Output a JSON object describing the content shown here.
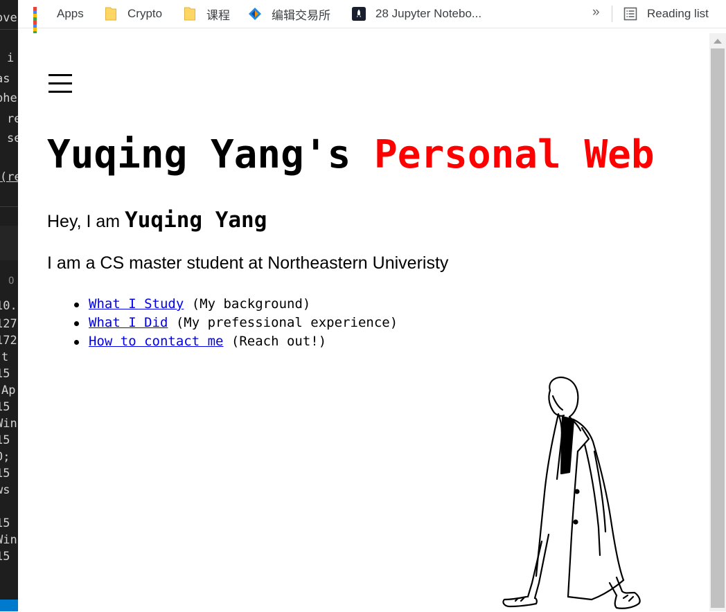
{
  "browser": {
    "bookmarks": [
      {
        "label": "Apps",
        "icon": "apps-grid-icon"
      },
      {
        "label": "Crypto",
        "icon": "folder-icon"
      },
      {
        "label": "课程",
        "icon": "folder-icon"
      },
      {
        "label": "编辑交易所",
        "icon": "exchange-logo-icon"
      },
      {
        "label": "28 Jupyter Notebo...",
        "icon": "rocket-icon"
      }
    ],
    "overflow_label": "»",
    "reading_list_label": "Reading list"
  },
  "editor_strip": {
    "lines": [
      "ove",
      "i",
      "as",
      "phe",
      "re",
      "se",
      "(re",
      "O",
      "10.",
      "127",
      "172",
      "t",
      "15",
      "Ap",
      "15",
      "Win",
      "15",
      "0;",
      "15",
      "ws",
      "15",
      "Win",
      "15"
    ]
  },
  "page": {
    "title_main": "Yuqing Yang's",
    "title_accent": "Personal Web",
    "greeting_prefix": "Hey, I am",
    "greeting_name": "Yuqing Yang",
    "intro": "I am a CS master student at Northeastern Univeristy",
    "links": [
      {
        "link": "What I Study",
        "note": "(My background)"
      },
      {
        "link": "What I Did",
        "note": "(My prefessional experience)"
      },
      {
        "link": "How to contact me",
        "note": "(Reach out!)"
      }
    ]
  },
  "colors": {
    "accent": "#ff0000",
    "link": "#0000ee",
    "editor_bg": "#1e1e1e"
  }
}
